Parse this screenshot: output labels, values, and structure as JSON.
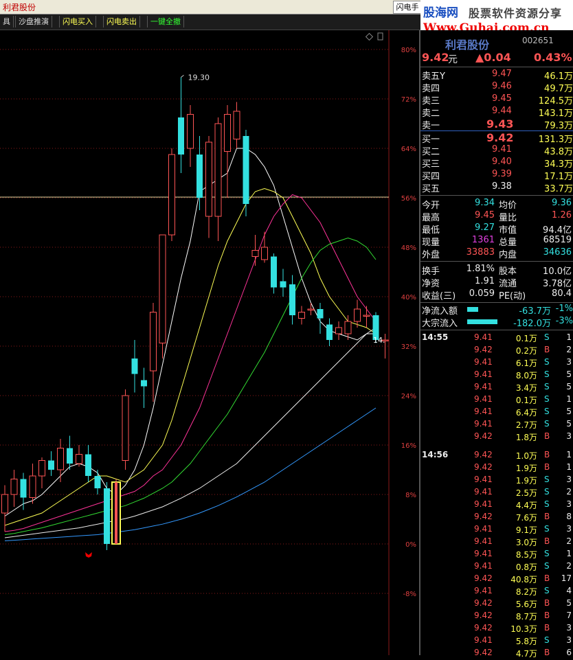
{
  "window": {
    "title": "利君股份",
    "flash_tab": "闪电手"
  },
  "toolbar": {
    "items": [
      {
        "label": "具"
      },
      {
        "label": "沙盘推演"
      },
      {
        "label": "闪电买入"
      },
      {
        "label": "闪电卖出"
      },
      {
        "label": "一键全撤"
      }
    ]
  },
  "logo": {
    "brand": "股海网",
    "slogan": "股票软件资源分享",
    "url": "Www.Guhai.com.cn"
  },
  "colors": {
    "up": "#ff5555",
    "down": "#33e0e0",
    "neutral": "#eeeeee",
    "volume": "#ffff55"
  },
  "chart": {
    "peak_label": "19.30",
    "last_label": "14.",
    "pct_axis": [
      "80%",
      "72%",
      "64%",
      "56%",
      "48%",
      "40%",
      "32%",
      "24%",
      "16%",
      "8%",
      "0%",
      "-8%"
    ]
  },
  "chart_data": {
    "type": "candlestick",
    "y_axis_unit": "percent",
    "ylim": [
      -12,
      82
    ],
    "grid": true,
    "candles": [
      {
        "o": 5,
        "c": 8,
        "h": 9.5,
        "l": 2
      },
      {
        "o": 8,
        "c": 10.5,
        "h": 12,
        "l": 6
      },
      {
        "o": 10.5,
        "c": 7.5,
        "h": 11.5,
        "l": 5.5
      },
      {
        "o": 7.5,
        "c": 11,
        "h": 13,
        "l": 6.5
      },
      {
        "o": 11,
        "c": 13.5,
        "h": 14,
        "l": 9
      },
      {
        "o": 13.5,
        "c": 12,
        "h": 15,
        "l": 11
      },
      {
        "o": 12,
        "c": 15.5,
        "h": 17,
        "l": 10
      },
      {
        "o": 15.5,
        "c": 13,
        "h": 17.5,
        "l": 12
      },
      {
        "o": 13,
        "c": 14.5,
        "h": 16,
        "l": 12.5
      },
      {
        "o": 14.5,
        "c": 11,
        "h": 16,
        "l": 10
      },
      {
        "o": 11,
        "c": 9,
        "h": 12,
        "l": 8
      },
      {
        "o": 9,
        "c": 0,
        "h": 10,
        "l": -1
      },
      {
        "o": 0,
        "c": 10,
        "h": 10.5,
        "l": 0,
        "marker": true
      },
      {
        "o": 13.5,
        "c": 24,
        "h": 25,
        "l": 12
      },
      {
        "o": 30,
        "c": 27.5,
        "h": 33,
        "l": 24.5
      },
      {
        "o": 26.5,
        "c": 25.5,
        "h": 28.5,
        "l": 22
      },
      {
        "o": 28,
        "c": 37.5,
        "h": 39,
        "l": 23
      },
      {
        "o": 32.5,
        "c": 50,
        "h": 50,
        "l": 30
      },
      {
        "o": 50,
        "c": 63,
        "h": 64,
        "l": 49
      },
      {
        "o": 69,
        "c": 63,
        "h": 75.5,
        "l": 60
      },
      {
        "o": 64,
        "c": 69.5,
        "h": 71,
        "l": 61
      },
      {
        "o": 63,
        "c": 56,
        "h": 66,
        "l": 54
      },
      {
        "o": 53,
        "c": 65,
        "h": 66,
        "l": 49.5
      },
      {
        "o": 53,
        "c": 68,
        "h": 69,
        "l": 49
      },
      {
        "o": 63.5,
        "c": 69.5,
        "h": 71,
        "l": 56
      },
      {
        "o": 65.5,
        "c": 70,
        "h": 71.5,
        "l": 64
      },
      {
        "o": 66,
        "c": 55,
        "h": 67,
        "l": 53
      },
      {
        "o": 46.5,
        "c": 47.5,
        "h": 50,
        "l": 45
      },
      {
        "o": 46,
        "c": 48,
        "h": 50.5,
        "l": 45.5
      },
      {
        "o": 46.5,
        "c": 41.5,
        "h": 47,
        "l": 40.5
      },
      {
        "o": 42.5,
        "c": 41.5,
        "h": 44.5,
        "l": 40
      },
      {
        "o": 42,
        "c": 37,
        "h": 43.5,
        "l": 35.5
      },
      {
        "o": 36.5,
        "c": 37.5,
        "h": 38.5,
        "l": 35.5
      },
      {
        "o": 38,
        "c": 38,
        "h": 39,
        "l": 37
      },
      {
        "o": 38,
        "c": 36.5,
        "h": 39,
        "l": 34
      },
      {
        "o": 35.5,
        "c": 33,
        "h": 36.5,
        "l": 32
      },
      {
        "o": 34,
        "c": 35,
        "h": 36,
        "l": 33
      },
      {
        "o": 34,
        "c": 36,
        "h": 37,
        "l": 33
      },
      {
        "o": 36,
        "c": 38,
        "h": 39.5,
        "l": 35
      },
      {
        "o": 37,
        "c": 37,
        "h": 38.5,
        "l": 35
      },
      {
        "o": 37,
        "c": 33,
        "h": 37.5,
        "l": 32.5
      },
      {
        "o": 33,
        "c": 33,
        "h": 34,
        "l": 30
      }
    ],
    "ma_lines": [
      {
        "name": "MA5",
        "color": "#ffffff",
        "values": [
          4.5,
          5.5,
          6.5,
          7,
          8,
          9.5,
          11,
          12.5,
          13,
          12.5,
          11.5,
          9,
          8,
          9.5,
          12,
          16,
          22,
          29,
          36,
          43,
          49,
          57,
          58,
          59,
          60,
          64,
          64,
          63,
          61,
          58,
          53,
          48,
          43,
          39,
          36,
          34.5,
          34,
          33.5,
          33,
          34,
          34
        ]
      },
      {
        "name": "MA10",
        "color": "#ffff55",
        "values": [
          3,
          3.5,
          4,
          4.5,
          5,
          6,
          7,
          8,
          9,
          10,
          11,
          11,
          10.5,
          10,
          11,
          12,
          14,
          16,
          20,
          25,
          30,
          35,
          40,
          45,
          49,
          52,
          55,
          57,
          57.5,
          57,
          56,
          53,
          50,
          47,
          43,
          40,
          38,
          36,
          35.5,
          35,
          34
        ]
      },
      {
        "name": "MA20",
        "color": "#ff3399",
        "values": [
          2,
          2.2,
          2.5,
          3,
          3.5,
          4,
          4.5,
          5,
          5.5,
          6,
          6.5,
          7,
          7.5,
          8,
          8.5,
          9.5,
          11,
          12,
          14,
          16,
          19,
          22,
          26,
          30,
          34,
          38,
          42,
          46,
          50,
          53,
          55,
          56.5,
          56,
          54,
          52,
          49,
          46,
          43,
          40,
          38,
          36
        ]
      },
      {
        "name": "MA30",
        "color": "#33dd33",
        "values": [
          1.5,
          1.7,
          2,
          2.3,
          2.6,
          3,
          3.4,
          3.8,
          4.2,
          4.6,
          5,
          5.4,
          5.8,
          6.2,
          6.8,
          7.4,
          8.2,
          9,
          10,
          11.5,
          13,
          15,
          17,
          19,
          21,
          23.5,
          26,
          28.5,
          31,
          34,
          37,
          40,
          43,
          45.5,
          47.5,
          48.5,
          49,
          49.5,
          49,
          48,
          46
        ]
      },
      {
        "name": "MA60",
        "color": "#eeeeee",
        "values": [
          1,
          1.2,
          1.4,
          1.6,
          1.8,
          2,
          2.2,
          2.4,
          2.6,
          2.9,
          3.2,
          3.5,
          3.8,
          4.1,
          4.5,
          5,
          5.5,
          6,
          6.7,
          7.4,
          8.2,
          9,
          10,
          11,
          12,
          13,
          14.5,
          16,
          17.5,
          19,
          20.5,
          22,
          23.5,
          25,
          26.5,
          28,
          29.5,
          31,
          32.5,
          34,
          35
        ]
      },
      {
        "name": "MA120",
        "color": "#3399ff",
        "values": [
          0.5,
          0.6,
          0.7,
          0.8,
          0.9,
          1,
          1.1,
          1.2,
          1.3,
          1.4,
          1.5,
          1.7,
          1.9,
          2.1,
          2.3,
          2.6,
          2.9,
          3.2,
          3.6,
          4,
          4.5,
          5,
          5.6,
          6.2,
          6.9,
          7.6,
          8.4,
          9.2,
          10,
          11,
          12,
          13,
          14,
          15,
          16,
          17,
          18,
          19,
          20,
          21,
          22
        ]
      }
    ]
  },
  "quote": {
    "name": "利君股份",
    "code": "002651",
    "price": "9.42",
    "unit": "元",
    "change": "▲0.04",
    "change_pct": "0.43%",
    "asks": [
      {
        "label": "卖五",
        "tag": "Y",
        "price": "9.47",
        "vol": "46.1万"
      },
      {
        "label": "卖四",
        "price": "9.46",
        "vol": "49.7万"
      },
      {
        "label": "卖三",
        "price": "9.45",
        "vol": "124.5万"
      },
      {
        "label": "卖二",
        "price": "9.44",
        "vol": "143.1万"
      },
      {
        "label": "卖一",
        "price": "9.43",
        "vol": "79.3万"
      }
    ],
    "bids": [
      {
        "label": "买一",
        "price": "9.42",
        "vol": "131.3万"
      },
      {
        "label": "买二",
        "price": "9.41",
        "vol": "43.8万"
      },
      {
        "label": "买三",
        "price": "9.40",
        "vol": "34.3万"
      },
      {
        "label": "买四",
        "price": "9.39",
        "vol": "17.1万"
      },
      {
        "label": "买五",
        "price": "9.38",
        "vol": "33.7万"
      }
    ],
    "stats": [
      {
        "l1": "今开",
        "v1": "9.34",
        "l2": "均价",
        "v2": "9.36"
      },
      {
        "l1": "最高",
        "v1": "9.45",
        "l2": "量比",
        "v2": "1.26"
      },
      {
        "l1": "最低",
        "v1": "9.27",
        "l2": "市值",
        "v2": "94.4亿"
      },
      {
        "l1": "现量",
        "v1": "1361",
        "l2": "总量",
        "v2": "68519"
      },
      {
        "l1": "外盘",
        "v1": "33883",
        "l2": "内盘",
        "v2": "34636"
      }
    ],
    "stats2": [
      {
        "l1": "换手",
        "v1": "1.81%",
        "l2": "股本",
        "v2": "10.0亿"
      },
      {
        "l1": "净资",
        "v1": "1.91",
        "l2": "流通",
        "v2": "3.78亿"
      },
      {
        "l1": "收益(三)",
        "v1": "0.059",
        "l2": "PE(动)",
        "v2": "80.4"
      }
    ],
    "flows": [
      {
        "label": "净流入额",
        "value": "-63.7万",
        "pct": "-1%",
        "bar": 0.3
      },
      {
        "label": "大宗流入",
        "value": "-182.0万",
        "pct": "-3%",
        "bar": 0.85
      }
    ],
    "ticks": [
      {
        "time": "14:55",
        "price": "9.41",
        "vol": "0.1万",
        "bs": "S",
        "n": "1"
      },
      {
        "time": "",
        "price": "9.42",
        "vol": "0.2万",
        "bs": "B",
        "n": "2"
      },
      {
        "time": "",
        "price": "9.41",
        "vol": "6.1万",
        "bs": "S",
        "n": "3"
      },
      {
        "time": "",
        "price": "9.41",
        "vol": "8.0万",
        "bs": "S",
        "n": "5"
      },
      {
        "time": "",
        "price": "9.41",
        "vol": "3.4万",
        "bs": "S",
        "n": "5"
      },
      {
        "time": "",
        "price": "9.41",
        "vol": "0.1万",
        "bs": "S",
        "n": "1"
      },
      {
        "time": "",
        "price": "9.41",
        "vol": "6.4万",
        "bs": "S",
        "n": "5"
      },
      {
        "time": "",
        "price": "9.41",
        "vol": "2.7万",
        "bs": "S",
        "n": "5"
      },
      {
        "time": "",
        "price": "9.42",
        "vol": "1.8万",
        "bs": "B",
        "n": "3"
      },
      {
        "time": "14:56",
        "price": "9.42",
        "vol": "1.0万",
        "bs": "B",
        "n": "1"
      },
      {
        "time": "",
        "price": "9.42",
        "vol": "1.9万",
        "bs": "B",
        "n": "1"
      },
      {
        "time": "",
        "price": "9.41",
        "vol": "1.9万",
        "bs": "S",
        "n": "3"
      },
      {
        "time": "",
        "price": "9.41",
        "vol": "2.5万",
        "bs": "S",
        "n": "2"
      },
      {
        "time": "",
        "price": "9.41",
        "vol": "4.4万",
        "bs": "S",
        "n": "3"
      },
      {
        "time": "",
        "price": "9.42",
        "vol": "7.6万",
        "bs": "B",
        "n": "8"
      },
      {
        "time": "",
        "price": "9.41",
        "vol": "9.1万",
        "bs": "S",
        "n": "3"
      },
      {
        "time": "",
        "price": "9.41",
        "vol": "3.0万",
        "bs": "B",
        "n": "2"
      },
      {
        "time": "",
        "price": "9.41",
        "vol": "8.5万",
        "bs": "S",
        "n": "1"
      },
      {
        "time": "",
        "price": "9.41",
        "vol": "0.8万",
        "bs": "S",
        "n": "2"
      },
      {
        "time": "",
        "price": "9.42",
        "vol": "40.8万",
        "bs": "B",
        "n": "17"
      },
      {
        "time": "",
        "price": "9.41",
        "vol": "8.2万",
        "bs": "S",
        "n": "4"
      },
      {
        "time": "",
        "price": "9.42",
        "vol": "5.6万",
        "bs": "B",
        "n": "5"
      },
      {
        "time": "",
        "price": "9.42",
        "vol": "8.7万",
        "bs": "B",
        "n": "7"
      },
      {
        "time": "",
        "price": "9.42",
        "vol": "10.3万",
        "bs": "B",
        "n": "3"
      },
      {
        "time": "",
        "price": "9.41",
        "vol": "5.8万",
        "bs": "S",
        "n": "3"
      },
      {
        "time": "",
        "price": "9.42",
        "vol": "4.7万",
        "bs": "B",
        "n": "6"
      }
    ]
  }
}
